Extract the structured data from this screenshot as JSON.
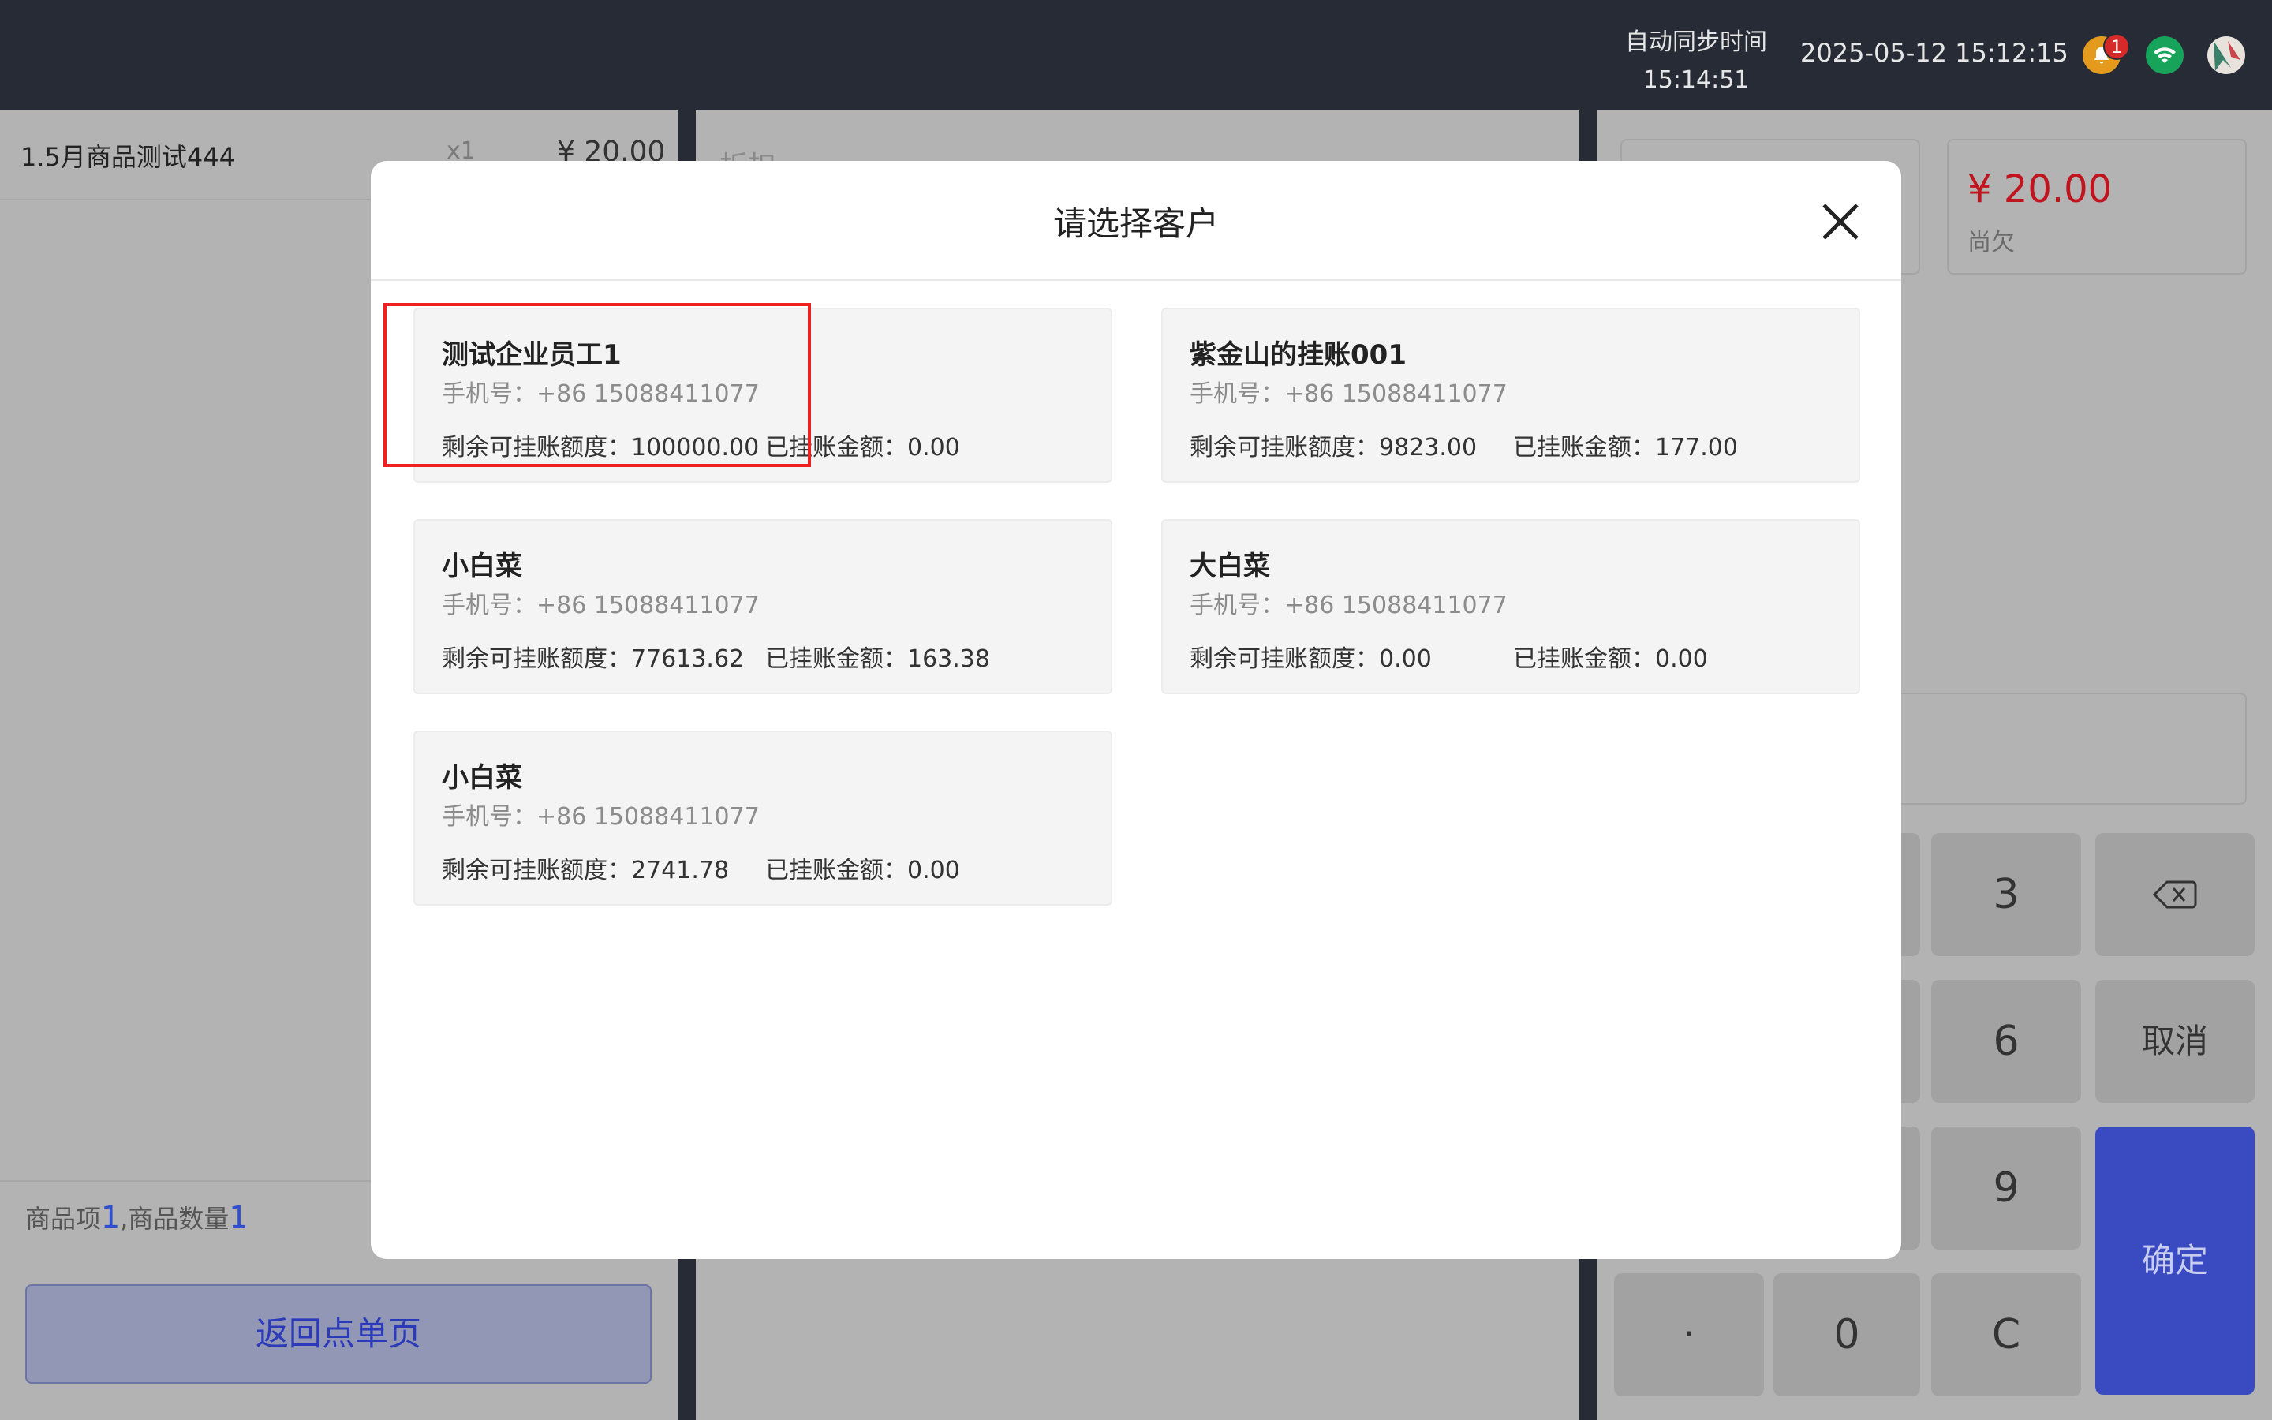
{
  "topbar": {
    "sync_label": "自动同步时间",
    "sync_time": "15:14:51",
    "datetime": "2025-05-12 15:12:15",
    "notification_count": "1",
    "icons": [
      "bell-icon",
      "wifi-icon",
      "avatar"
    ]
  },
  "order": {
    "item_name": "1.5月商品测试444",
    "item_qty": "x1",
    "item_price": "¥ 20.00",
    "summary_label_items": "商品项",
    "summary_items": "1",
    "summary_label_qty": ",商品数量",
    "summary_qty": "1",
    "back_button": "返回点单页"
  },
  "middle": {
    "hint": "折扣"
  },
  "right": {
    "owed_amount": "¥ 20.00",
    "owed_label": "尚欠",
    "keys": {
      "k3": "3",
      "backspace_icon": "backspace-icon",
      "k6": "6",
      "cancel": "取消",
      "k9": "9",
      "confirm": "确定",
      "dot": "·",
      "k0": "0",
      "clear": "C"
    }
  },
  "modal": {
    "title": "请选择客户",
    "customers": [
      {
        "name": "测试企业员工1",
        "phone": "手机号：+86 15088411077",
        "credit": "剩余可挂账额度：100000.00",
        "used": "已挂账金额：0.00"
      },
      {
        "name": "紫金山的挂账001",
        "phone": "手机号：+86 15088411077",
        "credit": "剩余可挂账额度：9823.00",
        "used": "已挂账金额：177.00"
      },
      {
        "name": "小白菜",
        "phone": "手机号：+86 15088411077",
        "credit": "剩余可挂账额度：77613.62",
        "used": "已挂账金额：163.38"
      },
      {
        "name": "大白菜",
        "phone": "手机号：+86 15088411077",
        "credit": "剩余可挂账额度：0.00",
        "used": "已挂账金额：0.00"
      },
      {
        "name": "小白菜",
        "phone": "手机号：+86 15088411077",
        "credit": "剩余可挂账额度：2741.78",
        "used": "已挂账金额：0.00"
      }
    ]
  }
}
